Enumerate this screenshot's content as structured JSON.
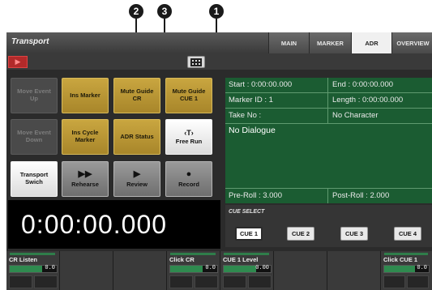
{
  "callouts": [
    "2",
    "3",
    "1"
  ],
  "header": {
    "title": "Transport",
    "tabs": [
      {
        "label": "MAIN",
        "active": false
      },
      {
        "label": "MARKER",
        "active": false
      },
      {
        "label": "ADR",
        "active": true
      },
      {
        "label": "OVERVIEW",
        "active": false
      }
    ]
  },
  "buttons": {
    "move_event_up": {
      "line1": "Move Event",
      "line2": "Up"
    },
    "ins_marker": {
      "line1": "Ins Marker"
    },
    "mute_guide_cr": {
      "line1": "Mute Guide",
      "line2": "CR"
    },
    "mute_guide_cue1": {
      "line1": "Mute Guide",
      "line2": "CUE 1"
    },
    "move_event_down": {
      "line1": "Move Event",
      "line2": "Down"
    },
    "ins_cycle_marker": {
      "line1": "Ins Cycle",
      "line2": "Marker"
    },
    "adr_status": {
      "line1": "ADR Status"
    },
    "free_run": {
      "glyph": "‹T›",
      "line1": "Free Run"
    },
    "transport_switch": {
      "line1": "Transport",
      "line2": "Swich"
    },
    "rehearse": {
      "glyph": "▶▶",
      "line1": "Rehearse"
    },
    "review": {
      "glyph": "▶",
      "line1": "Review"
    },
    "record": {
      "glyph": "●",
      "line1": "Record"
    }
  },
  "timecode": "0:00:00.000",
  "info": {
    "start": "Start : 0:00:00.000",
    "end": "End : 0:00:00.000",
    "marker_id": "Marker ID : 1",
    "length": "Length : 0:00:00.000",
    "take_no": "Take No :",
    "character": "No Character",
    "dialogue": "No Dialogue",
    "pre_roll": "Pre-Roll : 3.000",
    "post_roll": "Post-Roll : 2.000"
  },
  "cue_select": {
    "title": "CUE SELECT",
    "cues": [
      "CUE 1",
      "CUE 2",
      "CUE 3",
      "CUE 4"
    ],
    "active": "CUE 1"
  },
  "channels": [
    {
      "label": "CR Listen",
      "value": "0.0"
    },
    {
      "label": "",
      "value": ""
    },
    {
      "label": "",
      "value": ""
    },
    {
      "label": "Click CR",
      "value": "0.0"
    },
    {
      "label": "CUE 1 Level",
      "value": "0.00"
    },
    {
      "label": "",
      "value": ""
    },
    {
      "label": "",
      "value": ""
    },
    {
      "label": "Click CUE 1",
      "value": "0.0"
    }
  ],
  "colors": {
    "accent_gold": "#c9a640",
    "info_green": "#1b5c32",
    "play_red": "#b22a2a"
  }
}
